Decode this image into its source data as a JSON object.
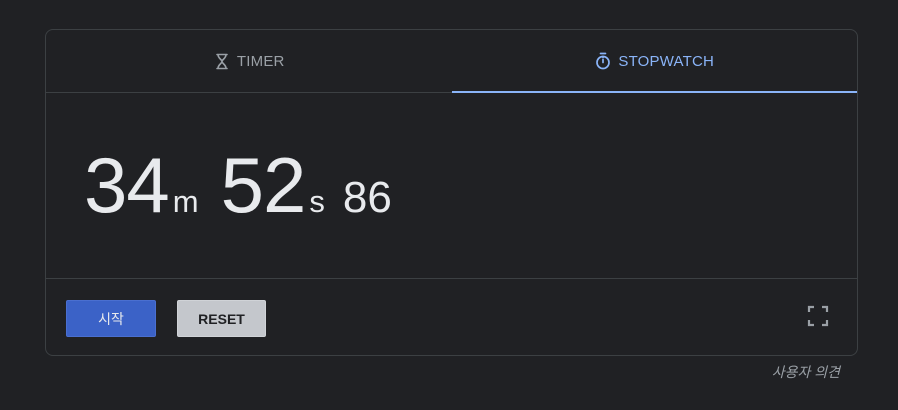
{
  "tabs": [
    {
      "label": "TIMER",
      "icon": "hourglass-icon",
      "active": false
    },
    {
      "label": "STOPWATCH",
      "icon": "stopwatch-icon",
      "active": true
    }
  ],
  "stopwatch": {
    "minutes": "34",
    "minutes_unit": "m",
    "seconds": "52",
    "seconds_unit": "s",
    "hundredths": "86"
  },
  "controls": {
    "start_label": "시작",
    "reset_label": "RESET"
  },
  "fullscreen_icon": "fullscreen-icon",
  "feedback_label": "사용자 의견",
  "colors": {
    "background": "#202124",
    "accent": "#8ab4f8",
    "start_button": "#3b62c7",
    "reset_button": "#c4c7cc",
    "text": "#e8eaed",
    "muted_text": "#9aa0a6"
  }
}
